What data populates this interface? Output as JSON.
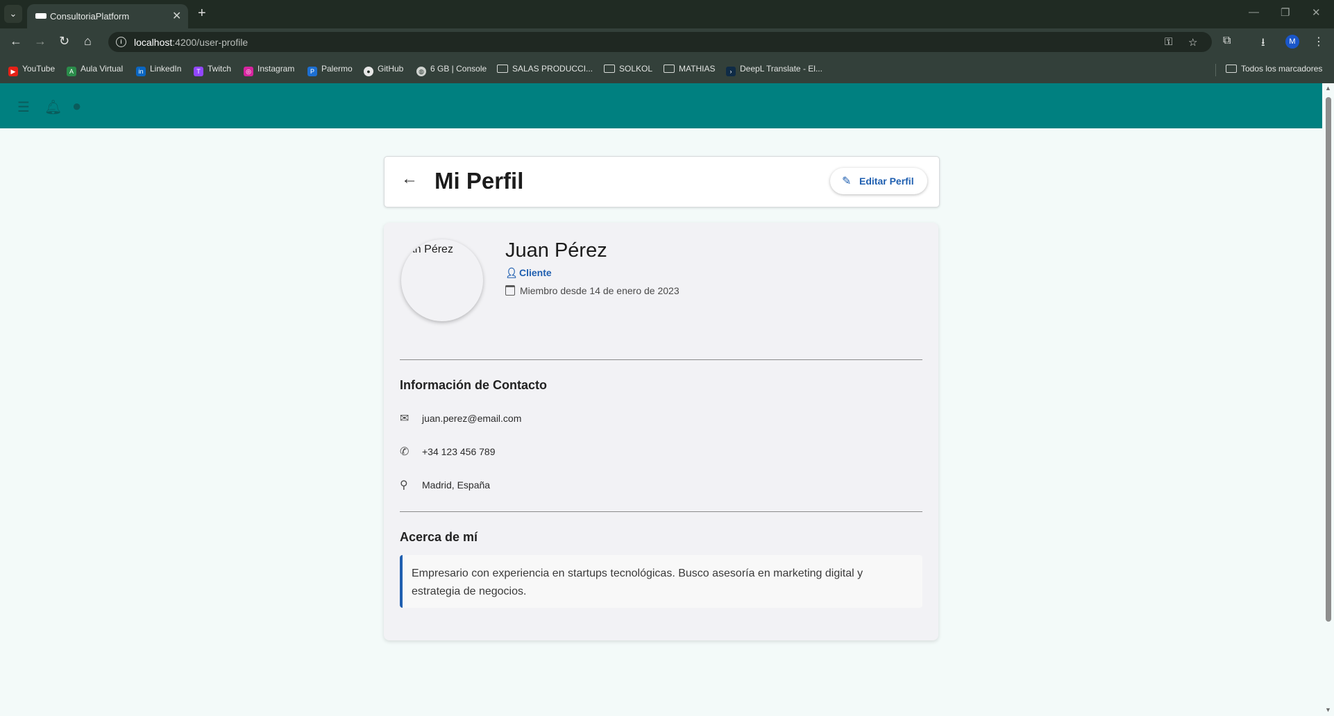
{
  "browser": {
    "tab": {
      "title": "ConsultoriaPlatform"
    },
    "url": {
      "host": "localhost",
      "path": ":4200/user-profile"
    },
    "profile_initial": "M",
    "bookmarks": [
      {
        "label": "YouTube",
        "icon": "youtube-icon",
        "color": "#e62117"
      },
      {
        "label": "Aula Virtual",
        "icon": "aula-icon",
        "color": "#2a8c4a"
      },
      {
        "label": "LinkedIn",
        "icon": "linkedin-icon",
        "color": "#0a66c2"
      },
      {
        "label": "Twitch",
        "icon": "twitch-icon",
        "color": "#9146ff"
      },
      {
        "label": "Instagram",
        "icon": "instagram-icon",
        "color": "#d6249f"
      },
      {
        "label": "Palermo",
        "icon": "palermo-icon",
        "color": "#1d6fd1"
      },
      {
        "label": "GitHub",
        "icon": "github-icon",
        "color": "#e6e6e6"
      },
      {
        "label": "6 GB | Console",
        "icon": "globe-icon",
        "color": "#cfd3cf"
      },
      {
        "label": "SALAS PRODUCCI...",
        "icon": "folder-icon"
      },
      {
        "label": "SOLKOL",
        "icon": "folder-icon"
      },
      {
        "label": "MATHIAS",
        "icon": "folder-icon"
      },
      {
        "label": "DeepL Translate - El...",
        "icon": "deepl-icon",
        "color": "#0f2b46"
      }
    ],
    "all_bookmarks": "Todos los marcadores"
  },
  "page": {
    "title": "Mi Perfil",
    "edit_button": "Editar Perfil",
    "avatar_alt": "Juan Pérez",
    "user_name": "Juan Pérez",
    "role": "Cliente",
    "member_since": "Miembro desde 14 de enero de 2023",
    "contact_title": "Información de Contacto",
    "contact": {
      "email": "juan.perez@email.com",
      "phone": "+34 123 456 789",
      "location": "Madrid, España"
    },
    "about_title": "Acerca de mí",
    "about_text": "Empresario con experiencia en startups tecnológicas. Busco asesoría en marketing digital y estrategia de negocios."
  },
  "colors": {
    "header": "#008080",
    "accent": "#1f5fb0"
  }
}
